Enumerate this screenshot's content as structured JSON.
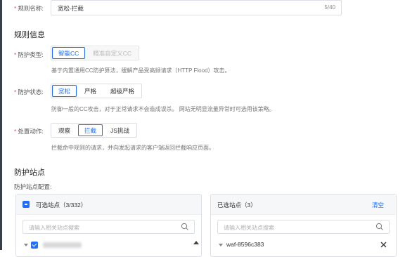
{
  "rule_name": {
    "label": "规则名称:",
    "value": "宽松-拦截",
    "counter": "5/40"
  },
  "rule_info": {
    "section_title": "规则信息",
    "protection_type": {
      "label": "防护类型:",
      "options": [
        "智能CC",
        "精准自定义CC"
      ],
      "selected": "智能CC",
      "help": "基于内置通用CC防护算法，缓解产品受高频请求（HTTP Flood）攻击。"
    },
    "protection_status": {
      "label": "防护状态:",
      "options": [
        "宽松",
        "严格",
        "超级严格"
      ],
      "selected": "宽松",
      "help": "防御一般的CC攻击，对于正常请求不会造成误杀。 网站无明显流量异常时可选用该策略。"
    },
    "action": {
      "label": "处置动作:",
      "options": [
        "观察",
        "拦截",
        "JS挑战"
      ],
      "selected": "拦截",
      "help": "拦截命中规则的请求，并向发起请求的客户端返回拦截响应页面。"
    }
  },
  "sites": {
    "section_title": "防护站点",
    "config_label": "防护站点配置:",
    "available": {
      "title": "可选站点（3/332）",
      "search_placeholder": "请输入相关站点搜索"
    },
    "selected": {
      "title": "已选站点（3）",
      "clear_label": "清空",
      "search_placeholder": "请输入相关站点搜索",
      "items": [
        "waf-8596c383"
      ]
    }
  },
  "colors": {
    "primary": "#1e6fff",
    "required": "#e34d59"
  }
}
